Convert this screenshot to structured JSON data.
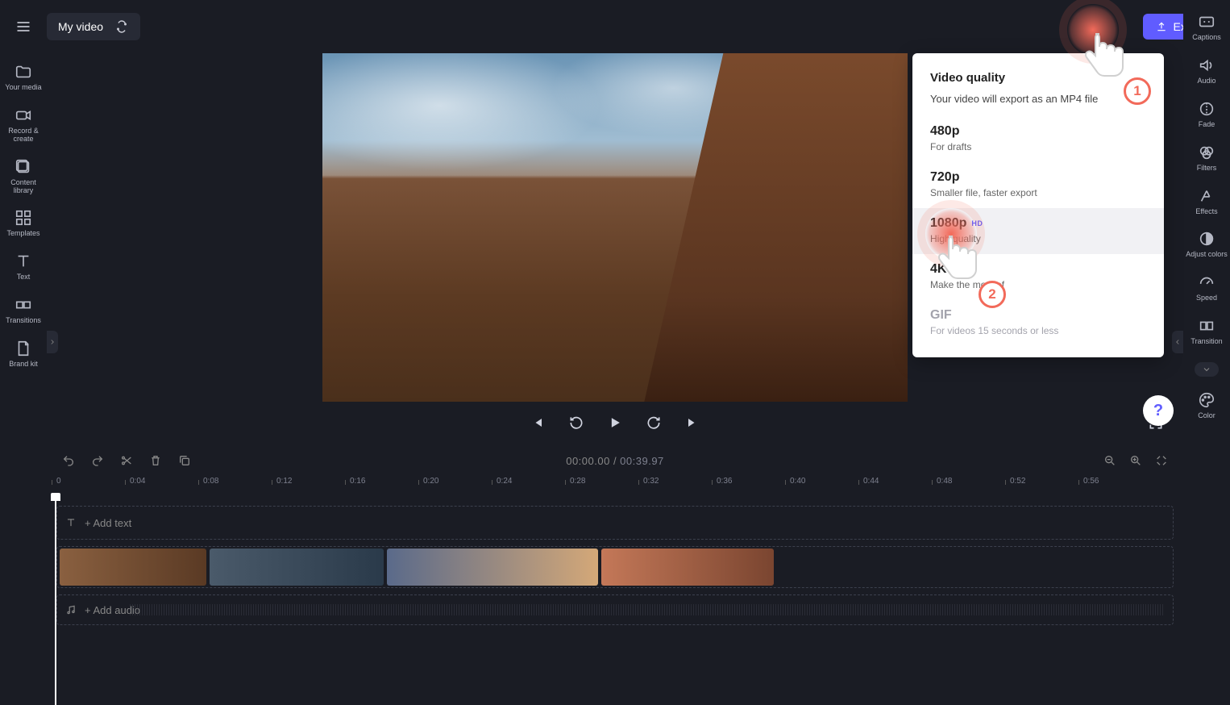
{
  "topbar": {
    "project_title": "My video",
    "export_label": "Export"
  },
  "left_sidebar": [
    {
      "icon": "folder",
      "label": "Your media"
    },
    {
      "icon": "camera",
      "label": "Record & create"
    },
    {
      "icon": "library",
      "label": "Content library"
    },
    {
      "icon": "grid",
      "label": "Templates"
    },
    {
      "icon": "text",
      "label": "Text"
    },
    {
      "icon": "transitions",
      "label": "Transitions"
    },
    {
      "icon": "brand",
      "label": "Brand kit"
    }
  ],
  "right_sidebar": [
    {
      "icon": "cc",
      "label": "Captions"
    },
    {
      "icon": "audio",
      "label": "Audio"
    },
    {
      "icon": "fade",
      "label": "Fade"
    },
    {
      "icon": "filters",
      "label": "Filters"
    },
    {
      "icon": "effects",
      "label": "Effects"
    },
    {
      "icon": "adjust",
      "label": "Adjust colors"
    },
    {
      "icon": "speed",
      "label": "Speed"
    },
    {
      "icon": "transition",
      "label": "Transition"
    },
    {
      "icon": "color",
      "label": "Color"
    }
  ],
  "export": {
    "heading": "Video quality",
    "subtitle": "Your video will export as an MP4 file",
    "options": [
      {
        "title": "480p",
        "desc": "For drafts",
        "badge": ""
      },
      {
        "title": "720p",
        "desc": "Smaller file, faster export",
        "badge": ""
      },
      {
        "title": "1080p",
        "desc": "High quality",
        "badge": "HD",
        "highlight": true
      },
      {
        "title": "4K",
        "desc": "Make the most of",
        "badge": "UHD"
      },
      {
        "title": "GIF",
        "desc": "For videos 15 seconds or less",
        "badge": "",
        "disabled": true
      }
    ]
  },
  "timeline": {
    "current": "00:00.00",
    "duration": "00:39.97",
    "ticks": [
      "0",
      "0:04",
      "0:08",
      "0:12",
      "0:16",
      "0:20",
      "0:24",
      "0:28",
      "0:32",
      "0:36",
      "0:40",
      "0:44",
      "0:48",
      "0:52",
      "0:56"
    ],
    "add_text_label": "+ Add text",
    "add_audio_label": "+ Add audio"
  },
  "help_label": "?",
  "steps": {
    "s1": "1",
    "s2": "2"
  }
}
